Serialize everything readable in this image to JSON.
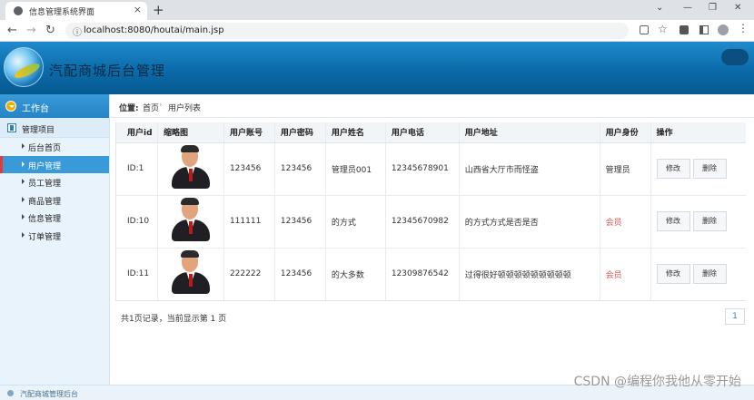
{
  "browser": {
    "tab_title": "信息管理系统界面",
    "tab_close": "×",
    "new_tab": "+",
    "url": "localhost:8080/houtai/main.jsp",
    "win_min": "—",
    "win_restore": "❐",
    "win_close": "✕",
    "back": "←",
    "forward": "→",
    "reload": "↻"
  },
  "header": {
    "title": "汽配商城后台管理"
  },
  "sidebar": {
    "workbench": "工作台",
    "group": "管理项目",
    "items": [
      {
        "label": "后台首页",
        "active": false
      },
      {
        "label": "用户管理",
        "active": true
      },
      {
        "label": "员工管理",
        "active": false
      },
      {
        "label": "商品管理",
        "active": false
      },
      {
        "label": "信息管理",
        "active": false
      },
      {
        "label": "订单管理",
        "active": false
      }
    ]
  },
  "breadcrumb": {
    "position_label": "位置:",
    "home": "首页",
    "separator": "›",
    "current": "用户列表"
  },
  "table": {
    "headers": [
      "用户id",
      "缩略图",
      "用户账号",
      "用户密码",
      "用户姓名",
      "用户电话",
      "用户地址",
      "用户身份",
      "操作"
    ],
    "rows": [
      {
        "id": "ID:1",
        "account": "123456",
        "password": "123456",
        "name": "管理员001",
        "phone": "12345678901",
        "address": "山西省大厅市而怪盗",
        "role": "管理员",
        "role_type": "admin"
      },
      {
        "id": "ID:10",
        "account": "111111",
        "password": "123456",
        "name": "的方式",
        "phone": "12345670982",
        "address": "的方式方式是否是否",
        "role": "会员",
        "role_type": "member"
      },
      {
        "id": "ID:11",
        "account": "222222",
        "password": "123456",
        "name": "的大多数",
        "phone": "12309876542",
        "address": "过得很好顿顿顿顿顿顿顿顿顿",
        "role": "会员",
        "role_type": "member"
      }
    ],
    "edit_label": "修改",
    "delete_label": "删除"
  },
  "pagination": {
    "summary": "共1页记录，当前显示第 1 页",
    "page": "1"
  },
  "status_bar": {
    "text": "汽配商城管理后台"
  },
  "watermark": "CSDN @编程你我他从零开始"
}
